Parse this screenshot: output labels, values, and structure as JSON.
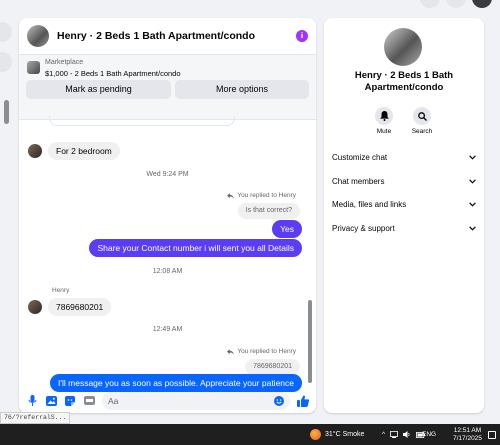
{
  "chat": {
    "title": "Henry · 2 Beds 1 Bath Apartment/condo",
    "marketplace_label": "Marketplace",
    "listing": "$1,000 - 2 Beds 1 Bath Apartment/condo",
    "btn_pending": "Mark as pending",
    "btn_more": "More options"
  },
  "messages": {
    "m1": "For 2 bedroom",
    "ts1": "Wed 9:24 PM",
    "replied1": "You replied to Henry",
    "quote1": "Is that correct?",
    "m2": "Yes",
    "m3": "Share your Contact number i will sent you all Details",
    "ts2": "12:08 AM",
    "sender": "Henry",
    "m4": "7869680201",
    "ts3": "12:49 AM",
    "replied2": "You replied to Henry",
    "quote2": "7869680201",
    "m5": "I'll message you as soon as possible. Appreciate your patience"
  },
  "composer": {
    "placeholder": "Aa"
  },
  "info": {
    "name": "Henry · 2 Beds 1 Bath Apartment/condo",
    "mute": "Mute",
    "search": "Search",
    "menu": [
      "Customize chat",
      "Chat members",
      "Media, files and links",
      "Privacy & support"
    ]
  },
  "status_url": "76/?referralS...",
  "taskbar": {
    "weather": "31°C  Smoke",
    "lang": "ENG",
    "time": "12:51 AM",
    "date": "7/17/2025"
  },
  "colors": {
    "outgoing": "#5b3df5",
    "outgoing_blue": "#0866ff",
    "accent": "#a033ff",
    "like": "#0866ff"
  },
  "icons": [
    "info-icon",
    "mic-icon",
    "image-icon",
    "sticker-icon",
    "gif-icon",
    "emoji-icon",
    "thumbs-up-icon",
    "bell-icon",
    "search-icon",
    "chevron-down-icon",
    "reply-icon",
    "weather-icon"
  ]
}
